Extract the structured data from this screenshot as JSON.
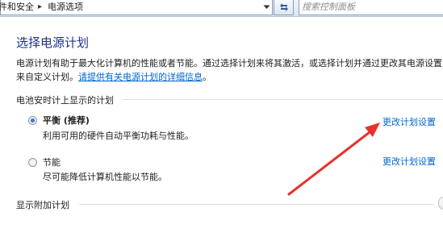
{
  "address_bar": {
    "crumbs": [
      {
        "label": "硬件和安全"
      },
      {
        "label": "电源选项"
      }
    ],
    "separator": "▸"
  },
  "search": {
    "placeholder": "搜索控制面板"
  },
  "main": {
    "title": "选择电源计划",
    "description_line1": "电源计划有助于最大化计算机的性能或者节能。通过选择计划来将其激活，或选择计划并通过更改其电源设置",
    "description_line2_prefix": "来自定义计划。",
    "description_link": "请提供有关电源计划的详细信息",
    "description_line2_suffix": "。",
    "group_header": "电池安时计上显示的计划",
    "plans": [
      {
        "name": "平衡 (推荐)",
        "description": "利用可用的硬件自动平衡功耗与性能。",
        "selected": true,
        "link": "更改计划设置"
      },
      {
        "name": "节能",
        "description": "尽可能降低计算机性能以节能。",
        "selected": false,
        "link": "更改计划设置"
      }
    ],
    "more_plans_header": "显示附加计划"
  },
  "colors": {
    "title": "#1e3287",
    "link": "#0066cc",
    "annotation_arrow": "#e8322b"
  },
  "icons": {
    "dropdown": "chevron-down-icon",
    "refresh": "refresh-icon",
    "expand": "expand-icon"
  }
}
